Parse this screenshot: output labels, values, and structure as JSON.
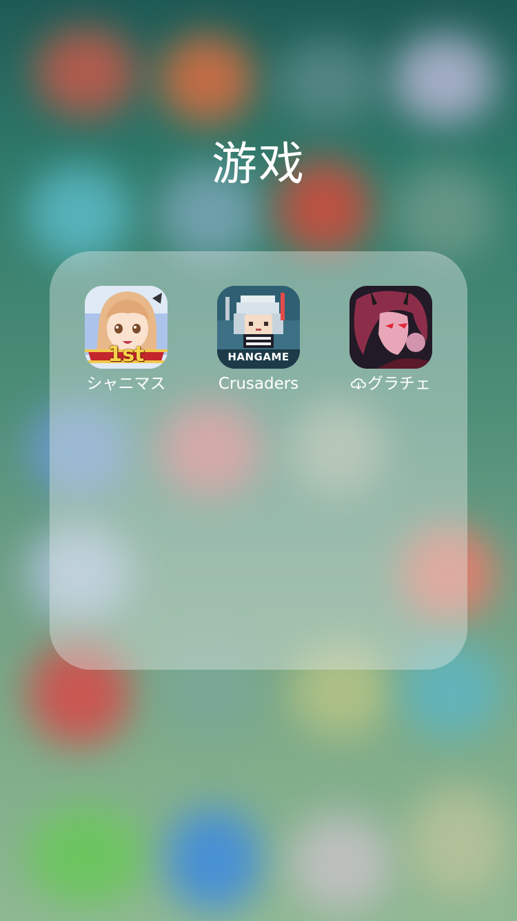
{
  "folder": {
    "title": "游戏"
  },
  "apps": [
    {
      "label": "シャニマス",
      "icon": "shinymas-app-icon",
      "badge_text": "1st",
      "downloading": false
    },
    {
      "label": "Crusaders",
      "icon": "crusaders-app-icon",
      "badge_text": "HANGAME",
      "downloading": false
    },
    {
      "label": "グラチェ",
      "icon": "grache-app-icon",
      "badge_text": "",
      "downloading": true,
      "status_icon": "icloud-download-icon"
    }
  ],
  "colors": {
    "label_text": "#ffffff",
    "folder_bg": "rgba(225,232,228,0.42)"
  }
}
